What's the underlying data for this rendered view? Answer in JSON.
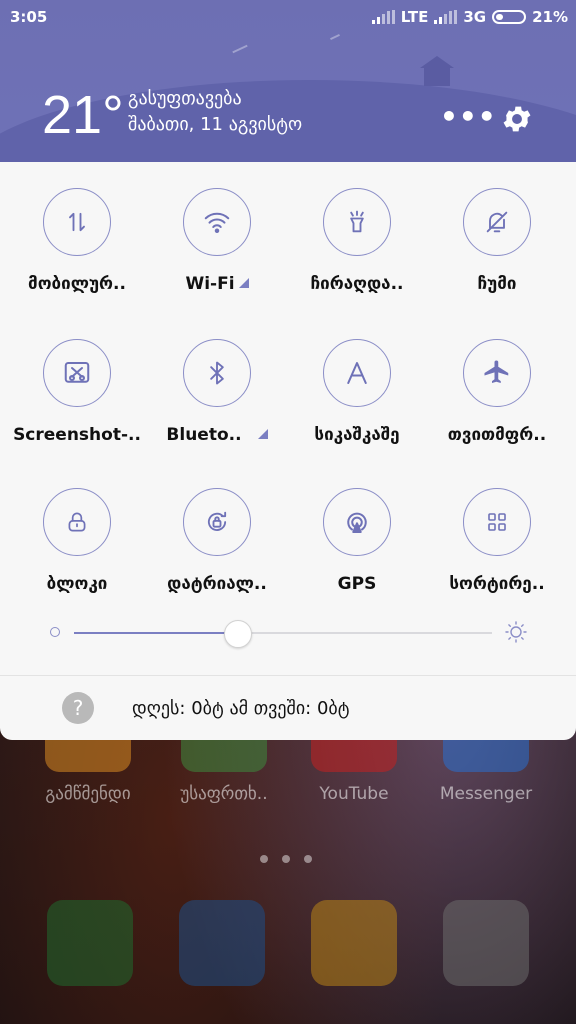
{
  "status_bar": {
    "time": "3:05",
    "network_1": "LTE",
    "network_2": "3G",
    "battery": "21%"
  },
  "weather": {
    "temperature": "21°",
    "condition": "გასუფთავება",
    "date": "შაბათი, 11 აგვისტო"
  },
  "header": {
    "more_label": "•••"
  },
  "quick_settings": {
    "tiles": [
      {
        "label": "მობილურ..",
        "icon": "mobile-data-icon"
      },
      {
        "label": "Wi-Fi",
        "icon": "wifi-icon",
        "has_submenu": true
      },
      {
        "label": "ჩირაღდა..",
        "icon": "flashlight-icon"
      },
      {
        "label": "ჩუმი",
        "icon": "silent-bell-icon"
      },
      {
        "label": "Screenshot-..",
        "icon": "screenshot-icon"
      },
      {
        "label": "Blueto..",
        "icon": "bluetooth-icon",
        "has_submenu": true
      },
      {
        "label": "სიკაშკაშე",
        "icon": "auto-brightness-icon"
      },
      {
        "label": "თვითმფრ..",
        "icon": "airplane-icon"
      },
      {
        "label": "ბლოკი",
        "icon": "lock-icon"
      },
      {
        "label": "დატრიალ..",
        "icon": "rotation-lock-icon"
      },
      {
        "label": "GPS",
        "icon": "gps-icon"
      },
      {
        "label": "სორტირე..",
        "icon": "sort-icon"
      }
    ]
  },
  "brightness": {
    "level_fraction": 0.39
  },
  "data_usage": {
    "help_icon": "?",
    "text": "დღეს: 0ბტ   ამ თვეში: 0ბტ"
  },
  "home_screen": {
    "apps_row1": [
      "გამწმენდი",
      "უსაფრთხ..",
      "YouTube",
      "Messenger"
    ],
    "dock": [
      "phone-icon",
      "contacts-icon",
      "messages-icon",
      "camera-icon"
    ]
  },
  "colors": {
    "header": "#6f72b7",
    "accent": "#7b7fc2",
    "panel": "#f7f7f7"
  }
}
